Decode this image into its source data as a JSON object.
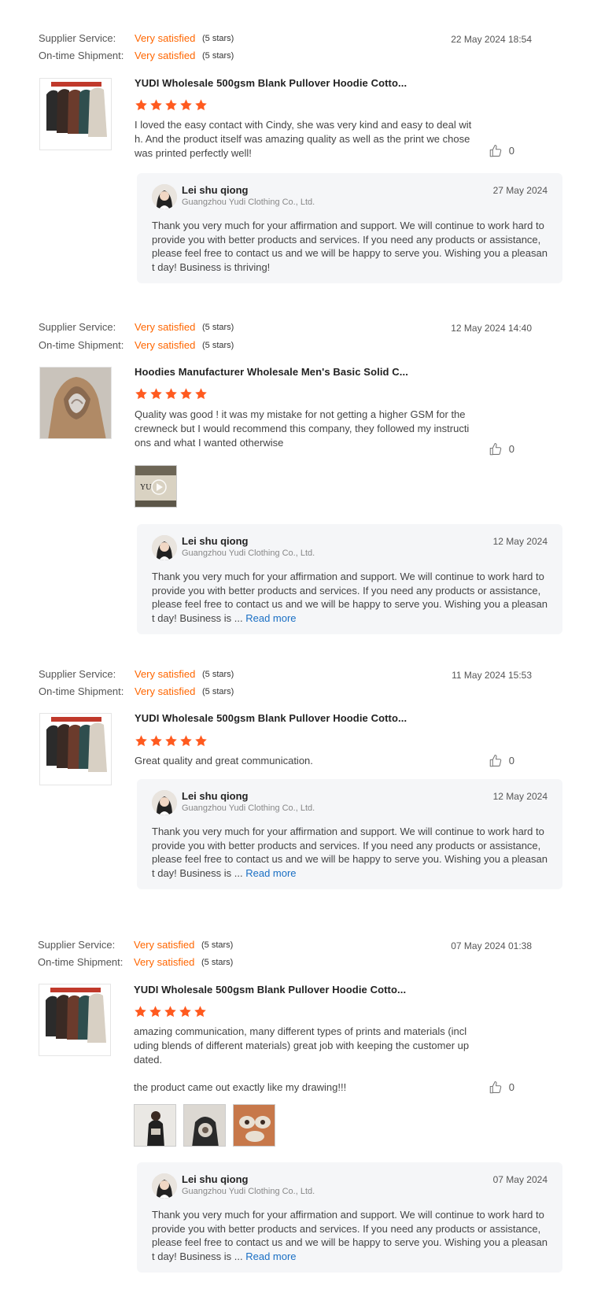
{
  "labels": {
    "supplier_service": "Supplier Service:",
    "on_time_shipment": "On-time Shipment:",
    "read_more": "Read more"
  },
  "colors": {
    "accent": "#ff6600",
    "star": "#ff5a1f",
    "link": "#1a6fc4",
    "reply_bg": "#f5f6f8"
  },
  "reviews": [
    {
      "date": "22 May 2024 18:54",
      "supplier_value": "Very satisfied",
      "supplier_stars": "(5 stars)",
      "shipment_value": "Very satisfied",
      "shipment_stars": "(5 stars)",
      "product_title": "YUDI Wholesale 500gsm Blank Pullover Hoodie Cotto...",
      "rating": 5,
      "comment": "I loved the easy contact with Cindy, she was very kind and easy to deal with. And the product itself was amazing quality as well as the print we chose was printed perfectly well!",
      "likes": "0",
      "reply": {
        "name": "Lei shu qiong",
        "company": "Guangzhou Yudi Clothing Co., Ltd.",
        "date": "27 May 2024",
        "text": "Thank you very much for your affirmation and support. We will continue to work hard to provide you with better products and services. If you need any products or assistance, please feel free to contact us and we will be happy to serve you. Wishing you a pleasant day! Business is thriving!"
      }
    },
    {
      "date": "12 May 2024 14:40",
      "supplier_value": "Very satisfied",
      "supplier_stars": "(5 stars)",
      "shipment_value": "Very satisfied",
      "shipment_stars": "(5 stars)",
      "product_title": "Hoodies Manufacturer Wholesale Men's Basic Solid C...",
      "rating": 5,
      "comment": "Quality was good ! it was my mistake for not getting a higher GSM for the crewneck but I would recommend this company, they followed my instructions and what I wanted otherwise",
      "likes": "0",
      "reply": {
        "name": "Lei shu qiong",
        "company": "Guangzhou Yudi Clothing Co., Ltd.",
        "date": "12 May 2024",
        "text": "Thank you very much for your affirmation and support. We will continue to work hard to provide you with better products and services. If you need any products or assistance, please feel free to contact us and we will be happy to serve you. Wishing you a pleasant day! Business is ... "
      }
    },
    {
      "date": "11 May 2024 15:53",
      "supplier_value": "Very satisfied",
      "supplier_stars": "(5 stars)",
      "shipment_value": "Very satisfied",
      "shipment_stars": "(5 stars)",
      "product_title": "YUDI Wholesale 500gsm Blank Pullover Hoodie Cotto...",
      "rating": 5,
      "comment": "Great quality and great communication.",
      "likes": "0",
      "reply": {
        "name": "Lei shu qiong",
        "company": "Guangzhou Yudi Clothing Co., Ltd.",
        "date": "12 May 2024",
        "text": "Thank you very much for your affirmation and support. We will continue to work hard to provide you with better products and services. If you need any products or assistance, please feel free to contact us and we will be happy to serve you. Wishing you a pleasant day! Business is ... "
      }
    },
    {
      "date": "07 May 2024 01:38",
      "supplier_value": "Very satisfied",
      "supplier_stars": "(5 stars)",
      "shipment_value": "Very satisfied",
      "shipment_stars": "(5 stars)",
      "product_title": "YUDI Wholesale 500gsm Blank Pullover Hoodie Cotto...",
      "rating": 5,
      "comment": "amazing communication, many different types of prints and materials (including blends of different materials) great job with keeping the customer updated.",
      "comment_extra": "the product came out exactly like my drawing!!!",
      "likes": "0",
      "reply": {
        "name": "Lei shu qiong",
        "company": "Guangzhou Yudi Clothing Co., Ltd.",
        "date": "07 May 2024",
        "text": "Thank you very much for your affirmation and support. We will continue to work hard to provide you with better products and services. If you need any products or assistance, please feel free to contact us and we will be happy to serve you. Wishing you a pleasant day! Business is ... "
      }
    }
  ]
}
